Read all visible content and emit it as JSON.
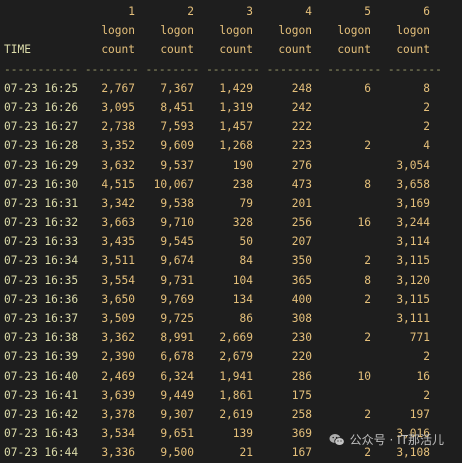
{
  "header": {
    "col_numbers": [
      "1",
      "2",
      "3",
      "4",
      "5",
      "6"
    ],
    "col_line1": [
      "logon",
      "logon",
      "logon",
      "logon",
      "logon",
      "logon"
    ],
    "col_line2": [
      "count",
      "count",
      "count",
      "count",
      "count",
      "count"
    ],
    "time_label": "TIME",
    "separator": "----------- -------- -------- -------- -------- -------- --------"
  },
  "rows": [
    {
      "time": "07-23 16:25",
      "v": [
        "2,767",
        "7,367",
        "1,429",
        "248",
        "6",
        "8"
      ]
    },
    {
      "time": "07-23 16:26",
      "v": [
        "3,095",
        "8,451",
        "1,319",
        "242",
        "",
        "2"
      ]
    },
    {
      "time": "07-23 16:27",
      "v": [
        "2,738",
        "7,593",
        "1,457",
        "222",
        "",
        "2"
      ]
    },
    {
      "time": "07-23 16:28",
      "v": [
        "3,352",
        "9,609",
        "1,268",
        "223",
        "2",
        "4"
      ]
    },
    {
      "time": "07-23 16:29",
      "v": [
        "3,632",
        "9,537",
        "190",
        "276",
        "",
        "3,054"
      ]
    },
    {
      "time": "07-23 16:30",
      "v": [
        "4,515",
        "10,067",
        "238",
        "473",
        "8",
        "3,658"
      ]
    },
    {
      "time": "07-23 16:31",
      "v": [
        "3,342",
        "9,538",
        "79",
        "201",
        "",
        "3,169"
      ]
    },
    {
      "time": "07-23 16:32",
      "v": [
        "3,663",
        "9,710",
        "328",
        "256",
        "16",
        "3,244"
      ]
    },
    {
      "time": "07-23 16:33",
      "v": [
        "3,435",
        "9,545",
        "50",
        "207",
        "",
        "3,114"
      ]
    },
    {
      "time": "07-23 16:34",
      "v": [
        "3,511",
        "9,674",
        "84",
        "350",
        "2",
        "3,115"
      ]
    },
    {
      "time": "07-23 16:35",
      "v": [
        "3,554",
        "9,731",
        "104",
        "365",
        "8",
        "3,120"
      ]
    },
    {
      "time": "07-23 16:36",
      "v": [
        "3,650",
        "9,769",
        "134",
        "400",
        "2",
        "3,115"
      ]
    },
    {
      "time": "07-23 16:37",
      "v": [
        "3,509",
        "9,725",
        "86",
        "308",
        "",
        "3,111"
      ]
    },
    {
      "time": "07-23 16:38",
      "v": [
        "3,362",
        "8,991",
        "2,669",
        "230",
        "2",
        "771"
      ]
    },
    {
      "time": "07-23 16:39",
      "v": [
        "2,390",
        "6,678",
        "2,679",
        "220",
        "",
        "2"
      ]
    },
    {
      "time": "07-23 16:40",
      "v": [
        "2,469",
        "6,324",
        "1,941",
        "286",
        "10",
        "16"
      ]
    },
    {
      "time": "07-23 16:41",
      "v": [
        "3,639",
        "9,449",
        "1,861",
        "175",
        "",
        "2"
      ]
    },
    {
      "time": "07-23 16:42",
      "v": [
        "3,378",
        "9,307",
        "2,619",
        "258",
        "2",
        "197"
      ]
    },
    {
      "time": "07-23 16:43",
      "v": [
        "3,534",
        "9,651",
        "139",
        "369",
        "",
        "3,016"
      ]
    },
    {
      "time": "07-23 16:44",
      "v": [
        "3,336",
        "9,500",
        "21",
        "167",
        "2",
        "3,108"
      ]
    }
  ],
  "watermark": {
    "text": "公众号 · IT那活儿",
    "icon": "wechat-icon"
  },
  "colors": {
    "background": "#1e1e1e",
    "number": "#e5c07b",
    "time": "#dcdcaa"
  }
}
